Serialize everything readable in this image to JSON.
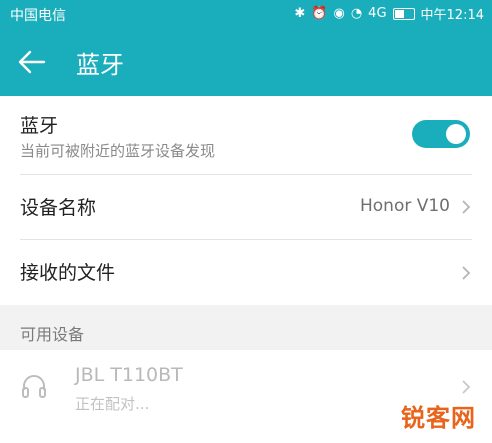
{
  "status_bar": {
    "carrier": "中国电信",
    "signal": "4G",
    "time": "中午12:14"
  },
  "toolbar": {
    "title": "蓝牙"
  },
  "bluetooth": {
    "label": "蓝牙",
    "description": "当前可被附近的蓝牙设备发现",
    "enabled": true
  },
  "device_name_row": {
    "label": "设备名称",
    "value": "Honor V10"
  },
  "received_files_row": {
    "label": "接收的文件"
  },
  "available_devices": {
    "header": "可用设备",
    "items": [
      {
        "name": "JBL T110BT",
        "status": "正在配对..."
      }
    ]
  },
  "watermark": "锐客网",
  "colors": {
    "accent": "#1aaebc",
    "watermark": "#e8641b"
  }
}
